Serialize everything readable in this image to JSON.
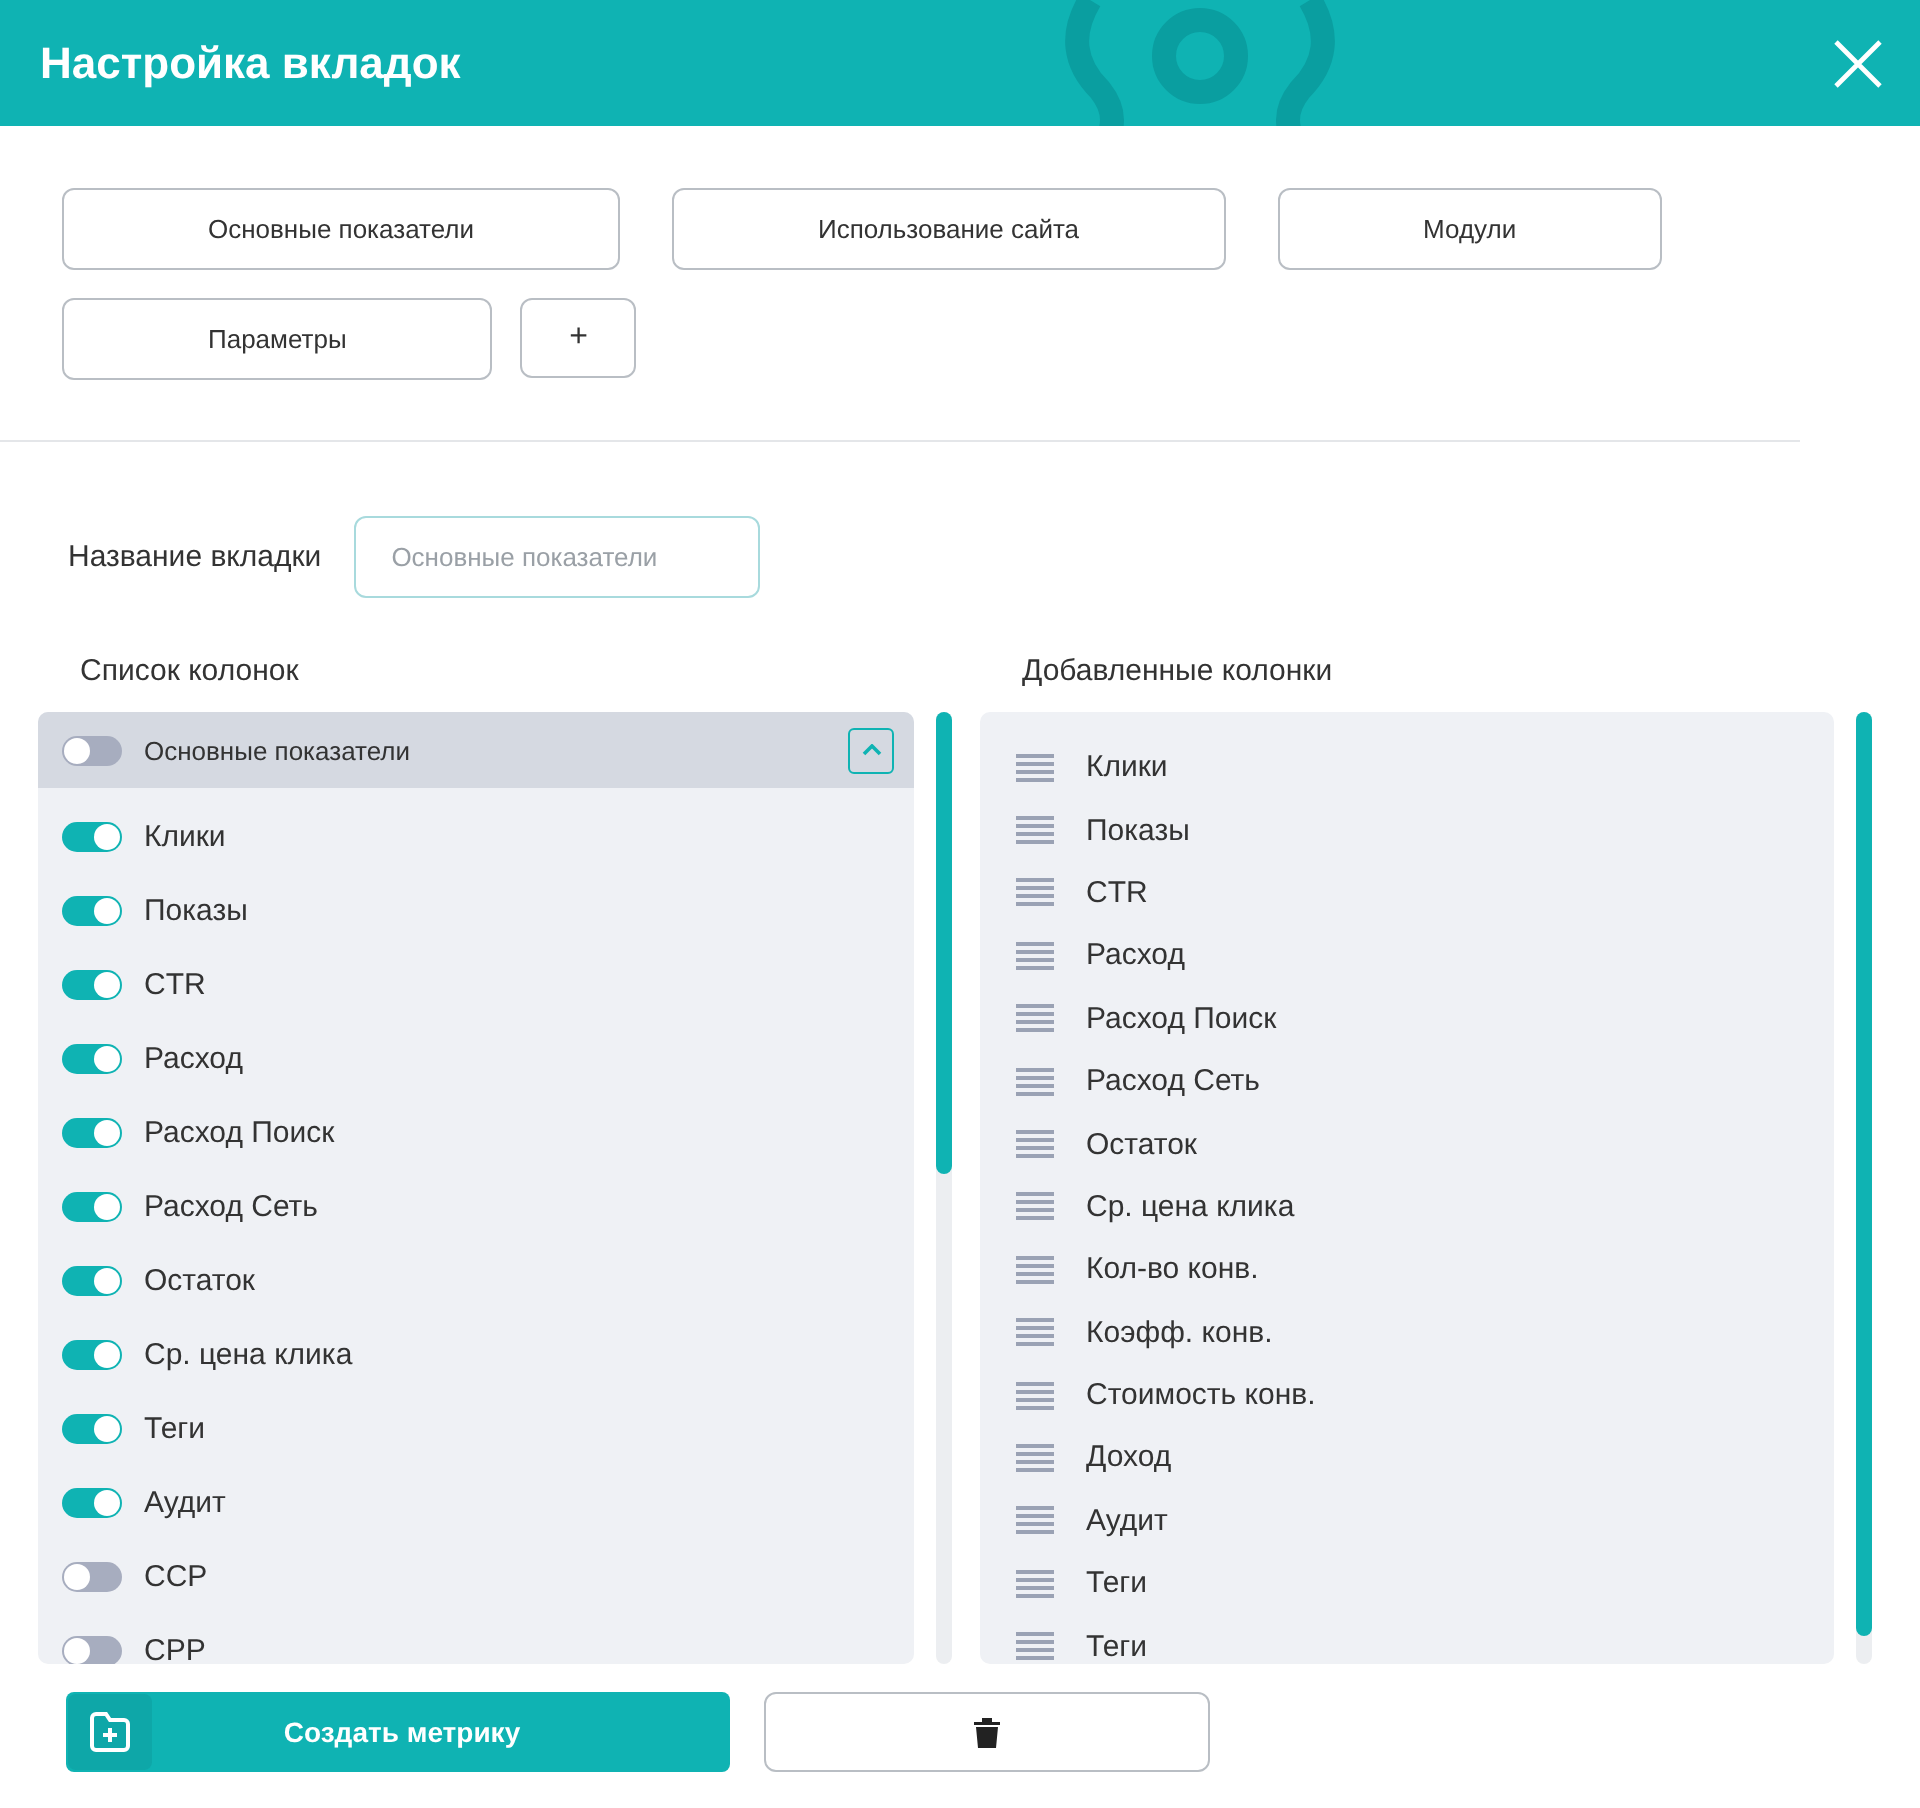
{
  "dialog": {
    "title": "Настройка вкладок"
  },
  "tabs": [
    {
      "label": "Основные показатели",
      "selected": false
    },
    {
      "label": "Использование сайта",
      "selected": false
    },
    {
      "label": "Модули",
      "selected": false
    },
    {
      "label": "Параметры",
      "selected": false
    }
  ],
  "add_tab_button": "+",
  "tab_name": {
    "label": "Название вкладки",
    "placeholder": "Основные показатели"
  },
  "columns_list": {
    "title": "Список колонок",
    "group": {
      "label": "Основные показатели",
      "on": false,
      "expanded": true
    },
    "items": [
      {
        "label": "Клики",
        "on": true
      },
      {
        "label": "Показы",
        "on": true
      },
      {
        "label": "CTR",
        "on": true
      },
      {
        "label": "Расход",
        "on": true
      },
      {
        "label": "Расход Поиск",
        "on": true
      },
      {
        "label": "Расход Сеть",
        "on": true
      },
      {
        "label": "Остаток",
        "on": true
      },
      {
        "label": "Ср. цена клика",
        "on": true
      },
      {
        "label": "Теги",
        "on": true
      },
      {
        "label": "Аудит",
        "on": true
      },
      {
        "label": "CCP",
        "on": false
      },
      {
        "label": "CPP",
        "on": false
      }
    ]
  },
  "added_columns": {
    "title": "Добавленные колонки",
    "items": [
      "Клики",
      "Показы",
      "CTR",
      "Расход",
      "Расход Поиск",
      "Расход Сеть",
      "Остаток",
      "Ср. цена клика",
      "Кол-во конв.",
      "Коэфф. конв.",
      "Стоимость конв.",
      "Доход",
      "Аудит",
      "Теги",
      "Теги"
    ]
  },
  "create_button": "Создать метрику"
}
